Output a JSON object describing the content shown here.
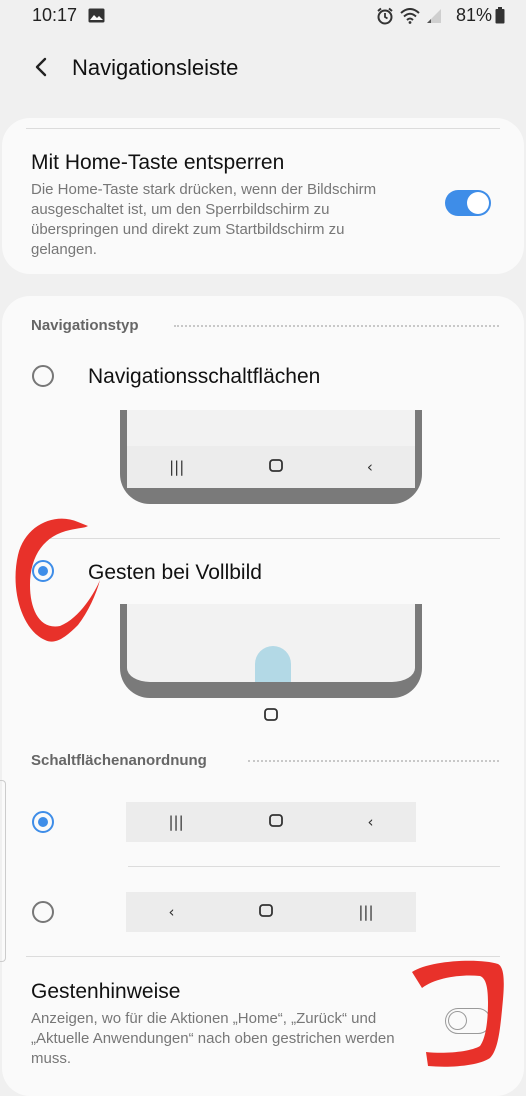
{
  "status": {
    "time": "10:17",
    "battery": "81%",
    "icons": [
      "image-icon",
      "alarm-icon",
      "wifi-icon",
      "signal-icon",
      "battery-icon"
    ]
  },
  "header": {
    "title": "Navigationsleiste",
    "back_icon": "back-arrow-icon"
  },
  "home_unlock": {
    "title": "Mit Home-Taste entsperren",
    "description": "Die Home-Taste stark drücken, wenn der Bildschirm ausgeschaltet ist, um den Sperrbildschirm zu überspringen und direkt zum Startbildschirm zu gelangen.",
    "enabled": true
  },
  "nav_type": {
    "section_label": "Navigationstyp",
    "options": [
      {
        "label": "Navigationsschaltflächen",
        "selected": false
      },
      {
        "label": "Gesten bei Vollbild",
        "selected": true
      }
    ]
  },
  "button_order": {
    "section_label": "Schaltflächenanordnung",
    "options": [
      {
        "glyphs": [
          "|||",
          "○",
          "‹"
        ],
        "selected": true
      },
      {
        "glyphs": [
          "‹",
          "○",
          "|||"
        ],
        "selected": false
      }
    ]
  },
  "gesture_hints": {
    "title": "Gestenhinweise",
    "description": "Anzeigen, wo für die Aktionen „Home“, „Zurück“ und „Aktuelle Anwendungen“ nach oben gestrichen werden muss.",
    "enabled": false
  },
  "colors": {
    "accent": "#3e8de8",
    "annotation": "#e8312a",
    "gesture_handle": "#b3d9e6"
  }
}
